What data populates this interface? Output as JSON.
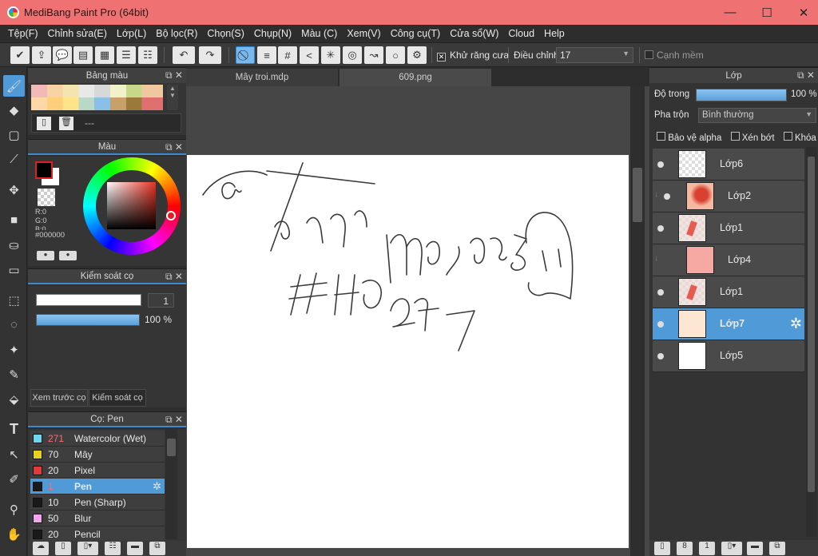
{
  "window": {
    "title": "MediBang Paint Pro (64bit)",
    "minimize": "—",
    "maximize": "☐",
    "close": "✕"
  },
  "menu": [
    "Tệp(F)",
    "Chỉnh sửa(E)",
    "Lớp(L)",
    "Bộ lọc(R)",
    "Chọn(S)",
    "Chụp(N)",
    "Màu (C)",
    "Xem(V)",
    "Công cụ(T)",
    "Cửa sổ(W)",
    "Cloud",
    "Help"
  ],
  "toolbar": {
    "antialias_label": "Khử răng cưa",
    "antialias_checked": true,
    "adjust_label": "Điều chỉnh",
    "adjust_value": "17",
    "soft_edge_label": "Cạnh mềm",
    "soft_edge_checked": false
  },
  "palette_panel": {
    "title": "Bảng màu",
    "name": "---"
  },
  "color_panel": {
    "title": "Màu",
    "r": "R:0",
    "g": "G:0",
    "b": "B:0",
    "hex": "#000000"
  },
  "brush_control": {
    "title": "Kiểm soát cọ",
    "size": "1",
    "opacity": "100 %",
    "opacity_fraction": 1.0
  },
  "bottom_tabs": [
    "Xem trước cọ",
    "Kiểm soát cọ"
  ],
  "brush_panel": {
    "title": "Cọ: Pen",
    "brushes": [
      {
        "size": "271",
        "name": "Watercolor (Wet)",
        "color": "#6fd4f0",
        "selected": false,
        "highlight": true
      },
      {
        "size": "70",
        "name": "Mây",
        "color": "#e8d21e",
        "selected": false,
        "highlight": false
      },
      {
        "size": "20",
        "name": "Pixel",
        "color": "#e03a3a",
        "selected": false,
        "highlight": false
      },
      {
        "size": "1",
        "name": "Pen",
        "color": "#1a1a1a",
        "selected": true,
        "highlight": true
      },
      {
        "size": "10",
        "name": "Pen (Sharp)",
        "color": "#1a1a1a",
        "selected": false,
        "highlight": false
      },
      {
        "size": "50",
        "name": "Blur",
        "color": "#f3a6ee",
        "selected": false,
        "highlight": false
      },
      {
        "size": "20",
        "name": "Pencil",
        "color": "#1a1a1a",
        "selected": false,
        "highlight": false
      }
    ]
  },
  "tabs": [
    {
      "label": "Mây troi.mdp",
      "active": false
    },
    {
      "label": "609.png",
      "active": true
    }
  ],
  "layer_panel": {
    "title": "Lớp",
    "opacity_label": "Độ trong",
    "opacity_value": "100 %",
    "opacity_fraction": 1.0,
    "blend_label": "Pha trộn",
    "blend_value": "Bình thường",
    "protect_alpha": "Bảo vệ alpha",
    "clip": "Xén bớt",
    "lock": "Khóa",
    "layers": [
      {
        "name": "Lớp6",
        "selected": false,
        "clipped": false
      },
      {
        "name": "Lớp2",
        "selected": false,
        "clipped": true
      },
      {
        "name": "Lớp1",
        "selected": false,
        "clipped": false
      },
      {
        "name": "Lớp4",
        "selected": false,
        "clipped": true
      },
      {
        "name": "Lớp1",
        "selected": false,
        "clipped": false
      },
      {
        "name": "Lớp7",
        "selected": true,
        "clipped": false
      },
      {
        "name": "Lớp5",
        "selected": false,
        "clipped": false
      }
    ]
  },
  "colors": {
    "accent": "#4f9ad7",
    "titlebar": "#f07171",
    "foreground": "#000000",
    "background": "#ffffff"
  }
}
